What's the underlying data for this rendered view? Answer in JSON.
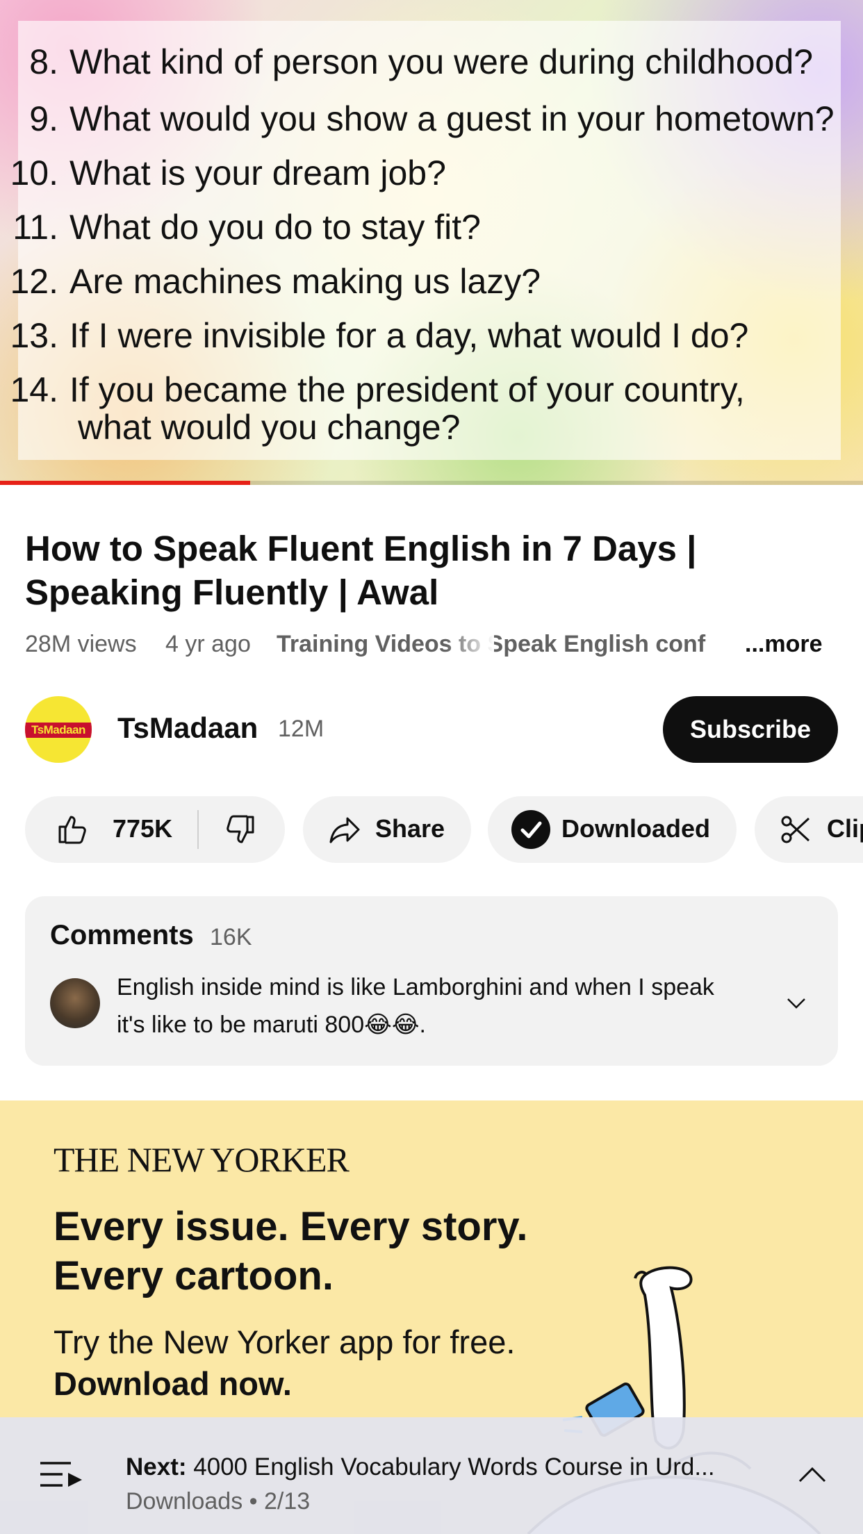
{
  "video": {
    "questions": [
      {
        "num": "8.",
        "text": "What kind of person you were during childhood?"
      },
      {
        "num": "9.",
        "text": "What would you show a guest in your hometown?"
      },
      {
        "num": "10.",
        "text": "What is your dream job?"
      },
      {
        "num": "11.",
        "text": "What do you do to stay fit?"
      },
      {
        "num": "12.",
        "text": "Are machines making us lazy?"
      },
      {
        "num": "13.",
        "text": "If I were invisible for a day, what would I do?"
      },
      {
        "num": "14.",
        "text": "If you became the president of your country,",
        "cont": "what would you change?"
      }
    ],
    "progress_fraction": 0.29,
    "progress_color": "#e62117"
  },
  "title": "How to Speak Fluent English in 7 Days | Speaking Fluently | Awal",
  "meta": {
    "views": "28M views",
    "age": "4 yr ago",
    "tag": "Training Videos to Speak English conf",
    "more": "...more"
  },
  "channel": {
    "avatar_text": "TsMadaan",
    "name": "TsMadaan",
    "subscribers": "12M",
    "subscribe_label": "Subscribe"
  },
  "actions": {
    "likes": "775K",
    "share": "Share",
    "downloaded": "Downloaded",
    "clip": "Clip"
  },
  "comments": {
    "label": "Comments",
    "count": "16K",
    "top_comment": "English inside mind is like Lamborghini and when I speak it's like to be maruti 800😂😂."
  },
  "ad": {
    "brand": "THE NEW YORKER",
    "headline_1": "Every issue. Every story.",
    "headline_2": "Every cartoon.",
    "sub_1": "Try the New Yorker app for free.",
    "sub_2": "Download now.",
    "background": "#fbe8a6"
  },
  "next": {
    "prefix": "Next:",
    "title": "4000 English Vocabulary Words Course in Urd...",
    "subtitle": "Downloads • 2/13"
  },
  "icons": [
    "like-icon",
    "dislike-icon",
    "share-icon",
    "check-icon",
    "scissors-icon",
    "chevron-down-icon",
    "queue-icon",
    "chevron-up-icon"
  ]
}
